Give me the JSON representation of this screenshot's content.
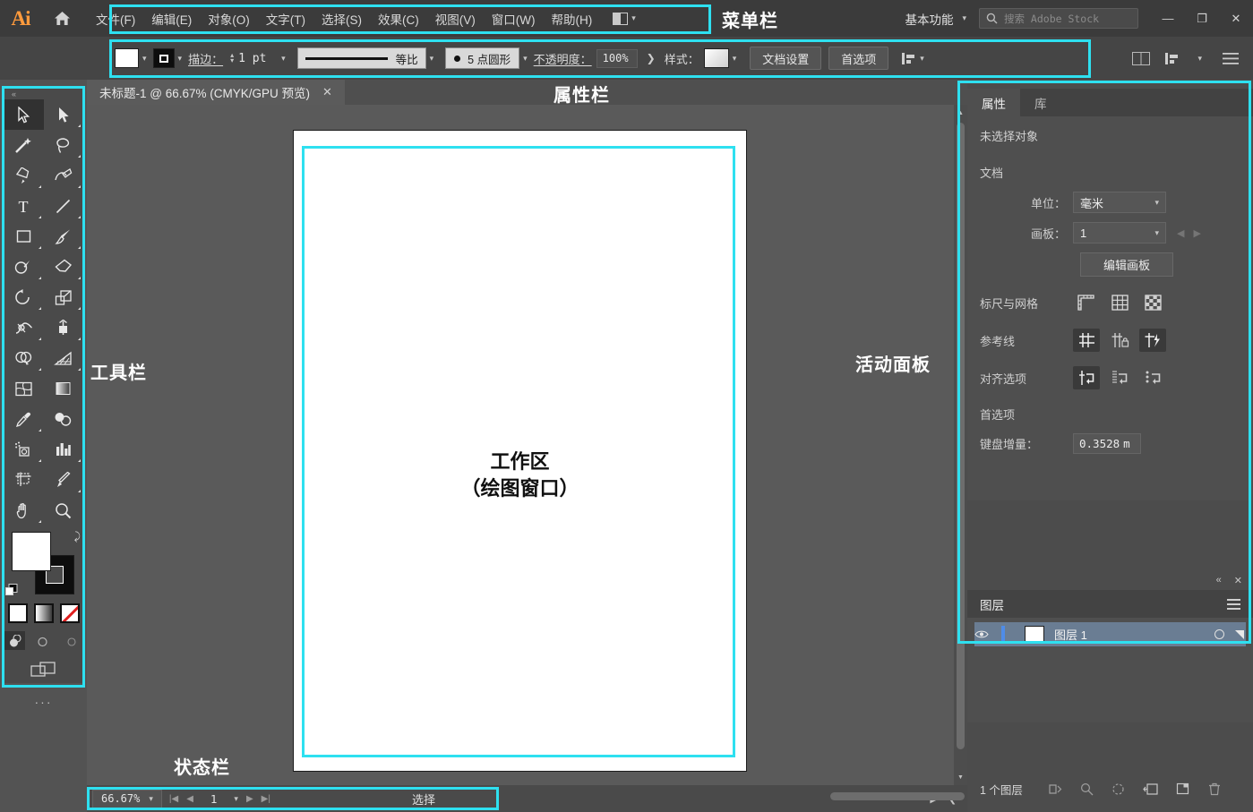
{
  "app": {
    "logo": "Ai",
    "home_icon": "home-icon"
  },
  "menubar": {
    "items": [
      {
        "label": "文件(F)"
      },
      {
        "label": "编辑(E)"
      },
      {
        "label": "对象(O)"
      },
      {
        "label": "文字(T)"
      },
      {
        "label": "选择(S)"
      },
      {
        "label": "效果(C)"
      },
      {
        "label": "视图(V)"
      },
      {
        "label": "窗口(W)"
      },
      {
        "label": "帮助(H)"
      }
    ],
    "arrange_documents_icon": "arrange-documents-icon",
    "workspace": "基本功能",
    "search_placeholder": "搜索 Adobe Stock",
    "search_icon": "search-icon",
    "minimize": "—",
    "maximize": "❐",
    "close": "✕"
  },
  "controlbar": {
    "fill_swatch": "fill-swatch",
    "stroke_swatch": "stroke-swatch",
    "stroke_label": "描边：",
    "stroke_weight": "1 pt",
    "profile_label": "等比",
    "brush_label": "5 点圆形",
    "opacity_label": "不透明度：",
    "opacity_value": "100%",
    "style_label": "样式：",
    "document_setup": "文档设置",
    "preferences": "首选项",
    "align_icon": "align-icon"
  },
  "toolbar": {
    "tools": [
      {
        "name": "selection-tool",
        "active": true
      },
      {
        "name": "direct-selection-tool",
        "active": false
      },
      {
        "name": "magic-wand-tool",
        "active": false
      },
      {
        "name": "lasso-tool",
        "active": false
      },
      {
        "name": "pen-tool",
        "active": false
      },
      {
        "name": "curvature-tool",
        "active": false
      },
      {
        "name": "type-tool",
        "active": false
      },
      {
        "name": "line-segment-tool",
        "active": false
      },
      {
        "name": "rectangle-tool",
        "active": false
      },
      {
        "name": "paintbrush-tool",
        "active": false
      },
      {
        "name": "shaper-tool",
        "active": false
      },
      {
        "name": "eraser-tool",
        "active": false
      },
      {
        "name": "rotate-tool",
        "active": false
      },
      {
        "name": "scale-tool",
        "active": false
      },
      {
        "name": "width-tool",
        "active": false
      },
      {
        "name": "free-transform-tool",
        "active": false
      },
      {
        "name": "shape-builder-tool",
        "active": false
      },
      {
        "name": "perspective-grid-tool",
        "active": false
      },
      {
        "name": "mesh-tool",
        "active": false
      },
      {
        "name": "gradient-tool",
        "active": false
      },
      {
        "name": "eyedropper-tool",
        "active": false
      },
      {
        "name": "blend-tool",
        "active": false
      },
      {
        "name": "symbol-sprayer-tool",
        "active": false
      },
      {
        "name": "column-graph-tool",
        "active": false
      },
      {
        "name": "artboard-tool",
        "active": false
      },
      {
        "name": "slice-tool",
        "active": false
      },
      {
        "name": "hand-tool",
        "active": false
      },
      {
        "name": "zoom-tool",
        "active": false
      }
    ],
    "fill_color": "#ffffff",
    "stroke_color": "#000000",
    "color_modes": [
      "solid-color-icon",
      "gradient-icon",
      "none-color-icon"
    ],
    "screen_modes": [
      "normal-screen-mode-icon",
      "full-screen-menubar-icon",
      "full-screen-icon"
    ],
    "edit_toolbar": "···"
  },
  "document": {
    "tab_title": "未标题-1 @ 66.67% (CMYK/GPU 预览)",
    "close_icon": "✕",
    "canvas_note_line1": "工作区",
    "canvas_note_line2": "（绘图窗口）"
  },
  "statusbar": {
    "zoom": "66.67%",
    "artboard_number": "1",
    "current_tool": "选择"
  },
  "properties_panel": {
    "tabs": [
      {
        "label": "属性",
        "active": true
      },
      {
        "label": "库",
        "active": false
      }
    ],
    "no_selection": "未选择对象",
    "document_section": "文档",
    "unit_label": "单位：",
    "unit_value": "毫米",
    "artboard_label": "画板：",
    "artboard_value": "1",
    "edit_artboards": "编辑画板",
    "rulers_grids_label": "标尺与网格",
    "rulers_icons": [
      "show-rulers-icon",
      "show-grid-icon",
      "show-transparency-grid-icon"
    ],
    "guides_label": "参考线",
    "guides_icons": [
      "show-guides-icon",
      "lock-guides-icon",
      "smart-guides-icon"
    ],
    "snap_label": "对齐选项",
    "snap_icons": [
      "snap-to-point-icon",
      "snap-to-grid-icon",
      "snap-to-pixel-icon"
    ],
    "preferences_label": "首选项",
    "keyboard_increment_label": "键盘增量：",
    "keyboard_increment_value": "0.3528",
    "keyboard_increment_unit": "m"
  },
  "layers_panel": {
    "title": "图层",
    "menu_icon": "panel-menu-icon",
    "rows": [
      {
        "name": "图层 1",
        "visible_icon": "eye-icon",
        "target_icon": "target-circle-icon"
      }
    ],
    "count_label": "1 个图层",
    "footer_icons": [
      "locate-object-icon",
      "make-clipping-mask-icon",
      "create-sublayer-icon",
      "create-new-layer-icon",
      "delete-layer-icon"
    ]
  },
  "annotations": [
    {
      "id": "menubar-annotation",
      "label": "菜单栏"
    },
    {
      "id": "controlbar-annotation",
      "label": "属性栏"
    },
    {
      "id": "toolbar-annotation",
      "label": "工具栏"
    },
    {
      "id": "active-panel-annotation",
      "label": "活动面板"
    },
    {
      "id": "statusbar-annotation",
      "label": "状态栏"
    }
  ],
  "colors": {
    "highlight": "#2ee0f0",
    "panel_bg": "#4f4f4f",
    "canvas_bg": "#5a5a5a",
    "accent_orange": "#ff9a3c"
  }
}
